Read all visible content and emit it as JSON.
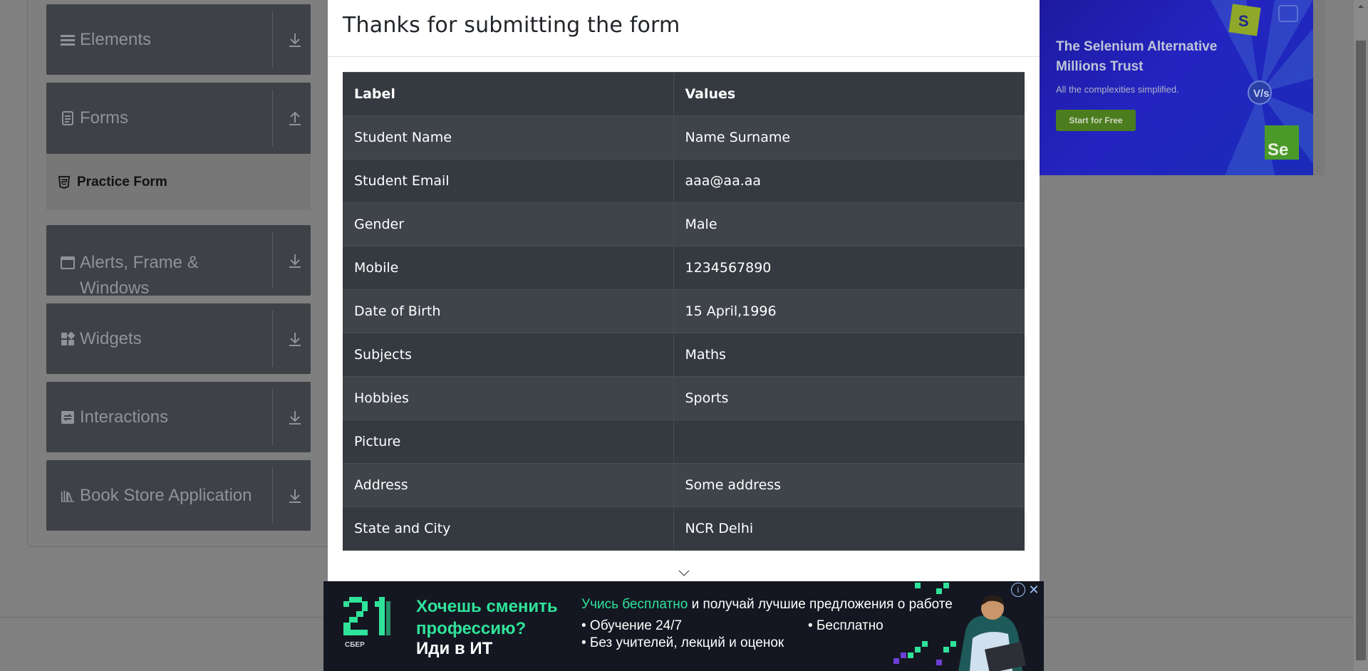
{
  "sidebar": {
    "groups": [
      {
        "label": "Elements",
        "icon": "hamburger-icon",
        "arrow": "download-icon"
      },
      {
        "label": "Forms",
        "icon": "document-icon",
        "arrow": "upload-icon"
      },
      {
        "label": "Alerts, Frame & Windows",
        "icon": "window-icon",
        "arrow": "download-icon"
      },
      {
        "label": "Widgets",
        "icon": "widgets-icon",
        "arrow": "download-icon"
      },
      {
        "label": "Interactions",
        "icon": "interactions-icon",
        "arrow": "download-icon"
      },
      {
        "label": "Book Store Application",
        "icon": "books-icon",
        "arrow": "download-icon"
      }
    ],
    "active_item": "Practice Form"
  },
  "ad_top": {
    "title": "The Selenium Alternative Millions Trust",
    "subtitle": "All the complexities simplified.",
    "button": "Start for Free"
  },
  "modal": {
    "title": "Thanks for submitting the form",
    "headers": [
      "Label",
      "Values"
    ],
    "rows": [
      [
        "Student Name",
        "Name Surname"
      ],
      [
        "Student Email",
        "aaa@aa.aa"
      ],
      [
        "Gender",
        "Male"
      ],
      [
        "Mobile",
        "1234567890"
      ],
      [
        "Date of Birth",
        "15 April,1996"
      ],
      [
        "Subjects",
        "Maths"
      ],
      [
        "Hobbies",
        "Sports"
      ],
      [
        "Picture",
        ""
      ],
      [
        "Address",
        "Some address"
      ],
      [
        "State and City",
        "NCR Delhi"
      ]
    ]
  },
  "ad_bottom": {
    "headline": "Хочешь сменить профессию?",
    "headline2": "Иди в ИТ",
    "line1_green": "Учись бесплатно",
    "line1_rest": " и получай лучшие предложения о работе",
    "bullet1": "• Обучение 24/7",
    "bullet2": "• Без учителей, лекций и оценок",
    "bullet3": "• Бесплатно",
    "logo_caption": "СБЕР"
  }
}
